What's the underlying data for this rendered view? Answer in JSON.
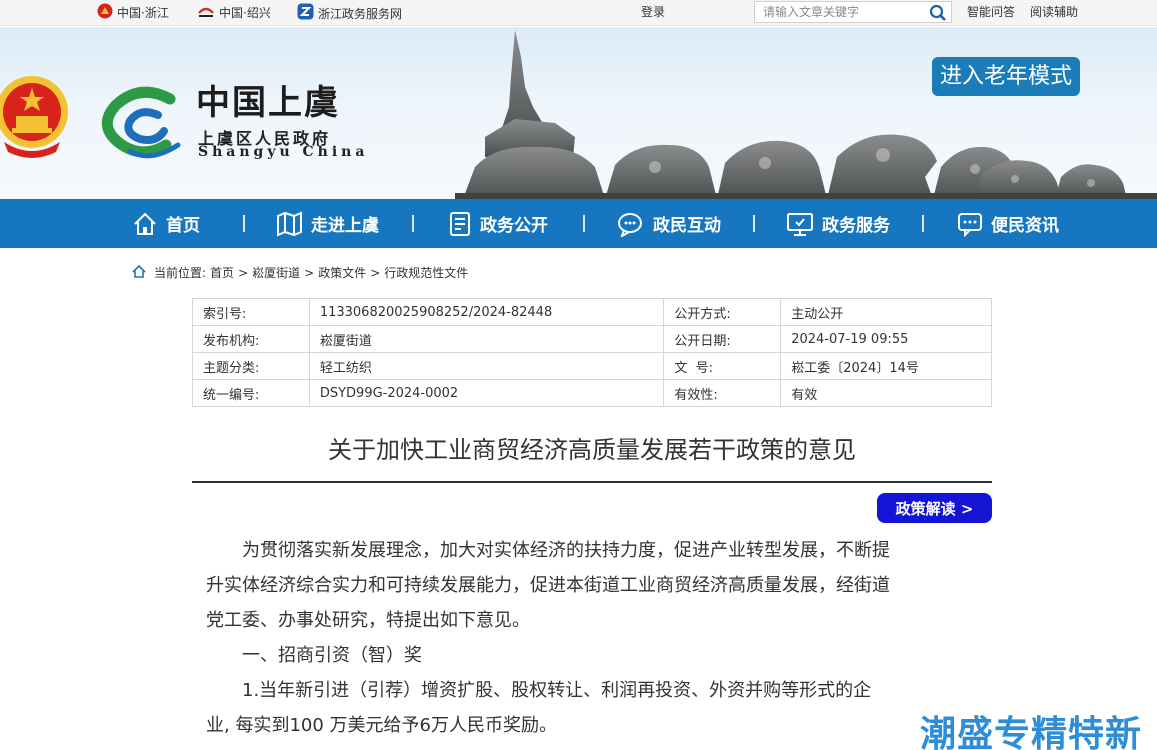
{
  "topbar": {
    "link_zhejiang": "中国·浙江",
    "link_shaoxing": "中国·绍兴",
    "link_zjzwfw": "浙江政务服务网",
    "login": "登录",
    "search_placeholder": "请输入文章关键字",
    "smart_qa": "智能问答",
    "reading_aid": "阅读辅助"
  },
  "banner": {
    "site_name": "中国上虞",
    "site_sub": "上虞区人民政府",
    "site_en": "Shangyu China",
    "elderly_mode": "进入老年模式"
  },
  "nav": {
    "items": [
      {
        "label": "首页",
        "icon": "home-icon"
      },
      {
        "label": "走进上虞",
        "icon": "map-icon"
      },
      {
        "label": "政务公开",
        "icon": "document-icon"
      },
      {
        "label": "政民互动",
        "icon": "chat-icon"
      },
      {
        "label": "政务服务",
        "icon": "monitor-icon"
      },
      {
        "label": "便民资讯",
        "icon": "message-icon"
      }
    ]
  },
  "breadcrumb": {
    "prefix": "当前位置:",
    "items": [
      "首页",
      "崧厦街道",
      "政策文件",
      "行政规范性文件"
    ],
    "sep": ">"
  },
  "meta": {
    "rows": [
      {
        "k1": "索引号:",
        "v1": "113306820025908252/2024-82448",
        "k2": "公开方式:",
        "v2": "主动公开"
      },
      {
        "k1": "发布机构:",
        "v1": "崧厦街道",
        "k2": "公开日期:",
        "v2": "2024-07-19 09:55"
      },
      {
        "k1": "主题分类:",
        "v1": "轻工纺织",
        "k2": "文  号:",
        "v2": "崧工委〔2024〕14号"
      },
      {
        "k1": "统一编号:",
        "v1": "DSYD99G-2024-0002",
        "k2": "有效性:",
        "v2": "有效"
      }
    ]
  },
  "article": {
    "title": "关于加快工业商贸经济高质量发展若干政策的意见",
    "interpret_button": "政策解读 >",
    "para1_line1": "　　为贯彻落实新发展理念，加大对实体经济的扶持力度，促进产业转型发展，不断提",
    "para1_line2": "升实体经济综合实力和可持续发展能力，促进本街道工业商贸经济高质量发展，经街道",
    "para1_line3": "党工委、办事处研究，特提出如下意见。",
    "heading1": "　　一、招商引资（智）奖",
    "item1_line1": "　　1.当年新引进（引荐）增资扩股、股权转让、利润再投资、外资并购等形式的企",
    "item1_line2": "业, 每实到100 万美元给予6万人民币奖励。"
  },
  "watermark": "潮盛专精特新",
  "colors": {
    "nav_bg": "#1676c0",
    "elderly_btn": "#1b7db8",
    "interp_btn": "#1414d4",
    "watermark": "#2d8dd6"
  }
}
